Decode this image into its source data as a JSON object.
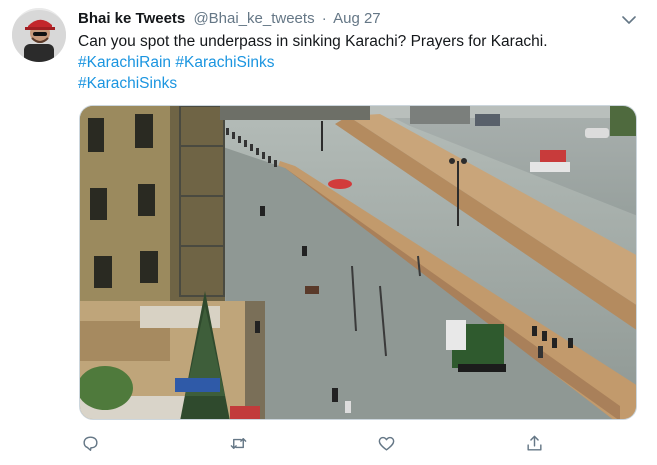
{
  "tweet": {
    "author_name": "Bhai ke Tweets",
    "handle": "@Bhai_ke_tweets",
    "separator": "·",
    "date": "Aug 27",
    "text_line1": "Can you spot the underpass in sinking Karachi? Prayers for Karachi.",
    "hashtags": [
      "#KarachiRain",
      "#KarachiSinks",
      "#KarachiSinks"
    ],
    "media_alt": "Aerial view of a flooded underpass in Karachi"
  },
  "icons": {
    "caret": "chevron-down-icon",
    "reply": "reply-icon",
    "retweet": "retweet-icon",
    "like": "heart-icon",
    "share": "share-icon"
  },
  "colors": {
    "link": "#1b95e0",
    "secondary_text": "#657786",
    "icon": "#657786",
    "water": "#9aa3a0"
  }
}
